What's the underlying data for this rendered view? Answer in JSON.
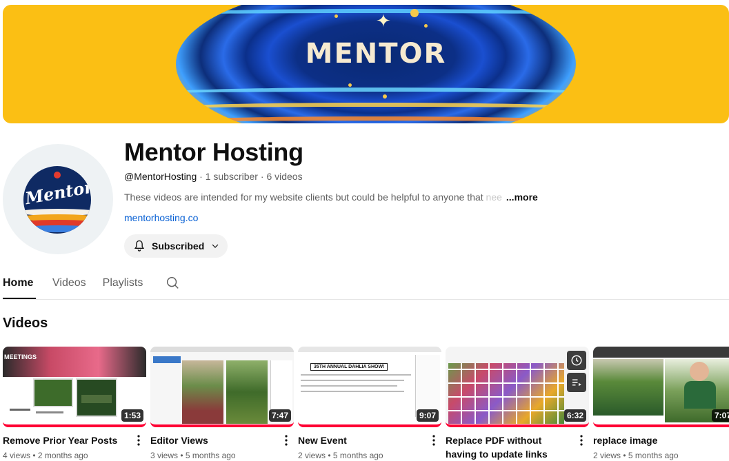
{
  "banner": {
    "text": "MENTOR"
  },
  "avatar": {
    "text": "Mentor"
  },
  "channel": {
    "name": "Mentor Hosting",
    "handle": "@MentorHosting",
    "subscribers": "1 subscriber",
    "videos_count": "6 videos",
    "description_visible": "These videos are intended for my website clients but could be helpful to anyone that ",
    "description_faded": "nee",
    "more_label": "...more",
    "link": "mentorhosting.co",
    "subscribed_label": "Subscribed"
  },
  "tabs": [
    {
      "label": "Home",
      "active": true
    },
    {
      "label": "Videos",
      "active": false
    },
    {
      "label": "Playlists",
      "active": false
    }
  ],
  "section_title": "Videos",
  "videos": [
    {
      "title": "Remove Prior Year Posts",
      "duration": "1:53",
      "views": "4 views",
      "age": "2 months ago",
      "thumb_text": "MEETINGS"
    },
    {
      "title": "Editor Views",
      "duration": "7:47",
      "views": "3 views",
      "age": "5 months ago"
    },
    {
      "title": "New Event",
      "duration": "9:07",
      "views": "2 views",
      "age": "5 months ago",
      "thumb_text": "35TH ANNUAL DAHLIA SHOW!"
    },
    {
      "title": "Replace PDF without having to update links",
      "duration": "6:32",
      "views": "",
      "age": ""
    },
    {
      "title": "replace image",
      "duration": "7:07",
      "views": "2 views",
      "age": "5 months ago"
    }
  ],
  "icons": {
    "bell": "bell-icon",
    "chevron": "chevron-down-icon",
    "search": "search-icon",
    "kebab": "more-vert-icon",
    "watch_later": "clock-icon",
    "add_queue": "queue-icon"
  },
  "colors": {
    "banner_bg": "#fbbf14",
    "progress_red": "#ff0033",
    "link_blue": "#065fd4"
  }
}
